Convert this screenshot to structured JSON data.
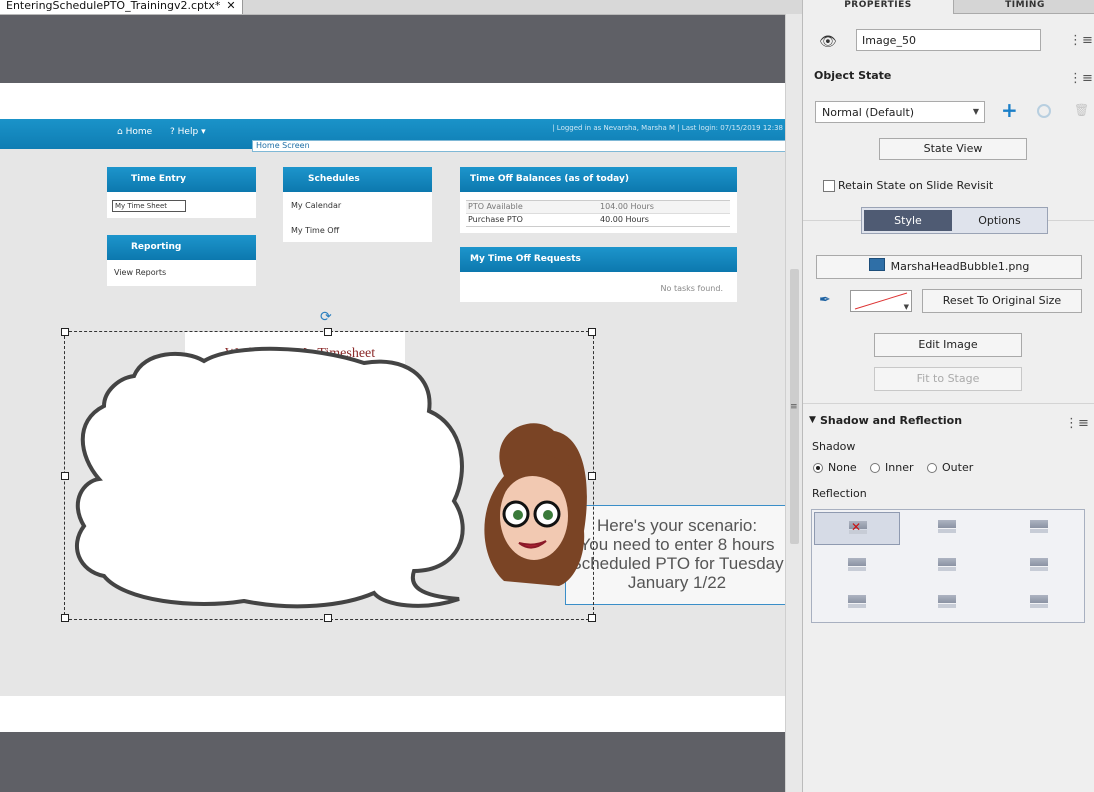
{
  "file_tab": {
    "name": "EnteringSchedulePTO_Trainingv2.cptx*",
    "close": "✕"
  },
  "slide": {
    "nav": {
      "home": "Home",
      "help": "Help",
      "breadcrumb": "Home Screen",
      "login_info": "|  Logged in as Nevarsha, Marsha M  |  Last login: 07/15/2019 12:38"
    },
    "cards": {
      "time_entry": {
        "title": "Time Entry",
        "field": "My Time Sheet"
      },
      "reporting": {
        "title": "Reporting",
        "link": "View Reports"
      },
      "schedules": {
        "title": "Schedules",
        "links": [
          "My Calendar",
          "My Time Off"
        ]
      },
      "balances": {
        "title": "Time Off Balances (as of today)",
        "rows": [
          [
            "PTO Available",
            "104.00 Hours"
          ],
          [
            "Purchase PTO",
            "40.00 Hours"
          ]
        ]
      },
      "requests": {
        "title": "My Time Off Requests",
        "empty": "No tasks found."
      }
    },
    "behind_text": "Working on My Timesheet",
    "scenario_lines": [
      "Here's your scenario:",
      "You need to enter 8 hours",
      "Scheduled PTO for Tuesday",
      "January 1/22"
    ]
  },
  "panel": {
    "tabs": {
      "properties": "PROPERTIES",
      "timing": "TIMING"
    },
    "object_name": "Image_50",
    "object_state_title": "Object State",
    "state_select": "Normal (Default)",
    "state_view": "State View",
    "retain_state": "Retain State on Slide Revisit",
    "style_tab": "Style",
    "options_tab": "Options",
    "image_file": "MarshaHeadBubble1.png",
    "reset_size": "Reset To Original Size",
    "edit_image": "Edit Image",
    "fit_stage": "Fit to Stage",
    "shadow_section": "Shadow and Reflection",
    "shadow_label": "Shadow",
    "shadow_options": [
      "None",
      "Inner",
      "Outer"
    ],
    "reflection_label": "Reflection"
  },
  "colors": {
    "accent": "#1a93c9",
    "panel_bg": "#efefef",
    "stage_bg": "#5f6066"
  }
}
